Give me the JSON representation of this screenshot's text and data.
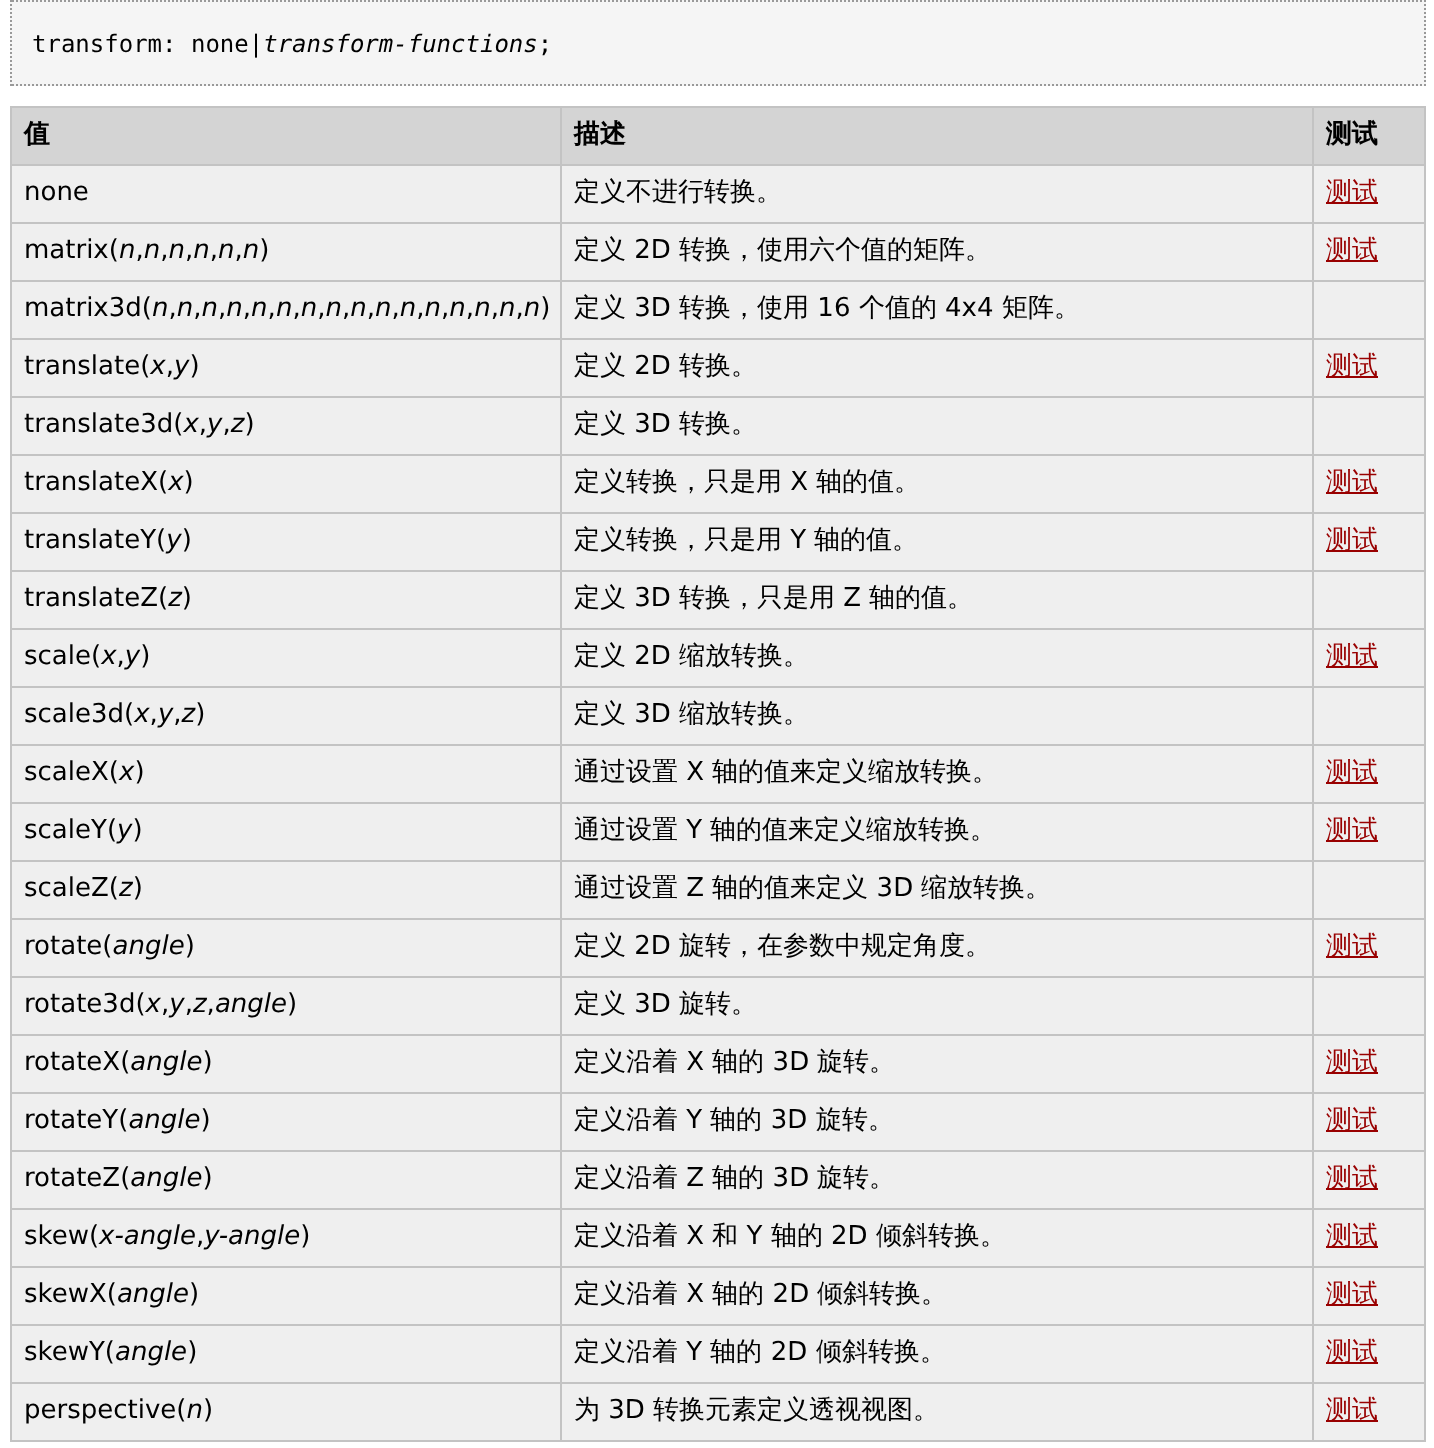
{
  "syntax": {
    "prefix": "transform: none|",
    "param": "transform-functions",
    "suffix": ";"
  },
  "table": {
    "columns": [
      "值",
      "描述",
      "测试"
    ],
    "rows": [
      {
        "value": "none",
        "description": "定义不进行转换。",
        "test": "测试"
      },
      {
        "value": "matrix(*n*,*n*,*n*,*n*,*n*,*n*)",
        "description": "定义 2D 转换，使用六个值的矩阵。",
        "test": "测试"
      },
      {
        "value": "matrix3d(*n*,*n*,*n*,*n*,*n*,*n*,*n*,*n*,*n*,*n*,*n*,*n*,*n*,*n*,*n*,*n*)",
        "description": "定义 3D 转换，使用 16 个值的 4x4 矩阵。"
      },
      {
        "value": "translate(*x*,*y*)",
        "description": "定义 2D 转换。",
        "test": "测试"
      },
      {
        "value": "translate3d(*x*,*y*,*z*)",
        "description": "定义 3D 转换。"
      },
      {
        "value": "translateX(*x*)",
        "description": "定义转换，只是用 X 轴的值。",
        "test": "测试"
      },
      {
        "value": "translateY(*y*)",
        "description": "定义转换，只是用 Y 轴的值。",
        "test": "测试"
      },
      {
        "value": "translateZ(*z*)",
        "description": "定义 3D 转换，只是用 Z 轴的值。"
      },
      {
        "value": "scale(*x*,*y*)",
        "description": "定义 2D 缩放转换。",
        "test": "测试"
      },
      {
        "value": "scale3d(*x*,*y*,*z*)",
        "description": "定义 3D 缩放转换。"
      },
      {
        "value": "scaleX(*x*)",
        "description": "通过设置 X 轴的值来定义缩放转换。",
        "test": "测试"
      },
      {
        "value": "scaleY(*y*)",
        "description": "通过设置 Y 轴的值来定义缩放转换。",
        "test": "测试"
      },
      {
        "value": "scaleZ(*z*)",
        "description": "通过设置 Z 轴的值来定义 3D 缩放转换。"
      },
      {
        "value": "rotate(*angle*)",
        "description": "定义 2D 旋转，在参数中规定角度。",
        "test": "测试"
      },
      {
        "value": "rotate3d(*x*,*y*,*z*,*angle*)",
        "description": "定义 3D 旋转。"
      },
      {
        "value": "rotateX(*angle*)",
        "description": "定义沿着 X 轴的 3D 旋转。",
        "test": "测试"
      },
      {
        "value": "rotateY(*angle*)",
        "description": "定义沿着 Y 轴的 3D 旋转。",
        "test": "测试"
      },
      {
        "value": "rotateZ(*angle*)",
        "description": "定义沿着 Z 轴的 3D 旋转。",
        "test": "测试"
      },
      {
        "value": "skew(*x-angle*,*y-angle*)",
        "description": "定义沿着 X 和 Y 轴的 2D 倾斜转换。",
        "test": "测试"
      },
      {
        "value": "skewX(*angle*)",
        "description": "定义沿着 X 轴的 2D 倾斜转换。",
        "test": "测试"
      },
      {
        "value": "skewY(*angle*)",
        "description": "定义沿着 Y 轴的 2D 倾斜转换。",
        "test": "测试"
      },
      {
        "value": "perspective(*n*)",
        "description": "为 3D 转换元素定义透视视图。",
        "test": "测试"
      }
    ]
  }
}
